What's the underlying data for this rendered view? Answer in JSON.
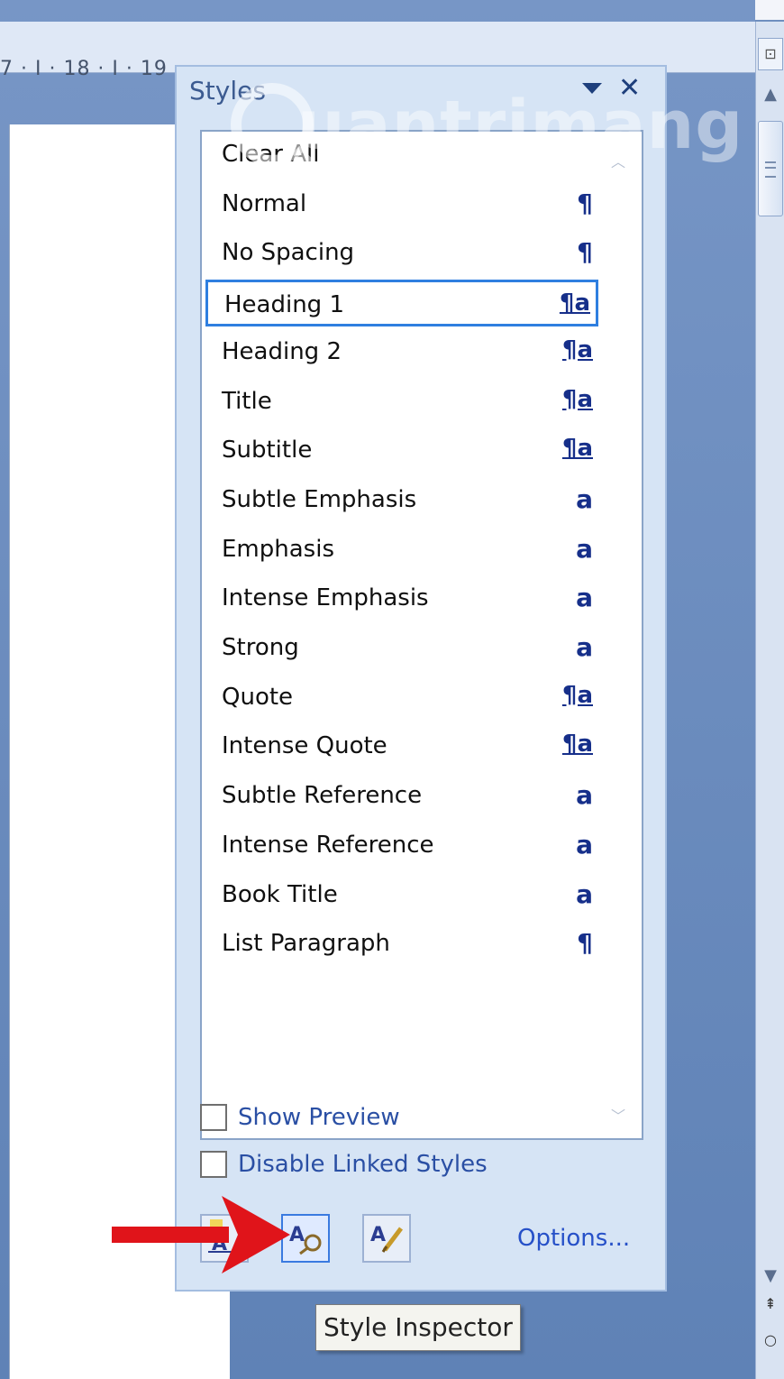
{
  "ruler": {
    "text": "7 · I · 18 · I · 19"
  },
  "pane": {
    "title": "Styles",
    "styles": [
      {
        "name": "Clear All",
        "icon": ""
      },
      {
        "name": "Normal",
        "icon": "¶",
        "icon_type": "paragraph"
      },
      {
        "name": "No Spacing",
        "icon": "¶",
        "icon_type": "paragraph"
      },
      {
        "name": "Heading 1",
        "icon": "¶a",
        "icon_type": "linked",
        "selected": true
      },
      {
        "name": "Heading 2",
        "icon": "¶a",
        "icon_type": "linked"
      },
      {
        "name": "Title",
        "icon": "¶a",
        "icon_type": "linked"
      },
      {
        "name": "Subtitle",
        "icon": "¶a",
        "icon_type": "linked"
      },
      {
        "name": "Subtle Emphasis",
        "icon": "a",
        "icon_type": "character"
      },
      {
        "name": "Emphasis",
        "icon": "a",
        "icon_type": "character"
      },
      {
        "name": "Intense Emphasis",
        "icon": "a",
        "icon_type": "character"
      },
      {
        "name": "Strong",
        "icon": "a",
        "icon_type": "character"
      },
      {
        "name": "Quote",
        "icon": "¶a",
        "icon_type": "linked"
      },
      {
        "name": "Intense Quote",
        "icon": "¶a",
        "icon_type": "linked"
      },
      {
        "name": "Subtle Reference",
        "icon": "a",
        "icon_type": "character"
      },
      {
        "name": "Intense Reference",
        "icon": "a",
        "icon_type": "character"
      },
      {
        "name": "Book Title",
        "icon": "a",
        "icon_type": "character"
      },
      {
        "name": "List Paragraph",
        "icon": "¶",
        "icon_type": "paragraph"
      }
    ],
    "show_preview_label": "Show Preview",
    "show_preview_checked": false,
    "disable_linked_label": "Disable Linked Styles",
    "disable_linked_checked": false,
    "buttons": {
      "new_style": "new-style-icon",
      "style_inspector": "style-inspector-icon",
      "manage_styles": "manage-styles-icon"
    },
    "options_label": "Options..."
  },
  "tooltip": {
    "text": "Style Inspector"
  },
  "watermark": {
    "text": "uantrimang"
  },
  "colors": {
    "accent": "#2f7fe0",
    "link": "#2650c8",
    "arrow": "#e0141a"
  }
}
